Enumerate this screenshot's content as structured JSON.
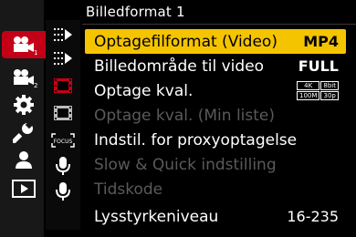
{
  "header": {
    "title": "Billedformat 1"
  },
  "menu": [
    {
      "label": "Optagefilformat (Video)",
      "value": "MP4",
      "state": "selected"
    },
    {
      "label": "Billedområde til video",
      "value": "FULL",
      "state": "normal"
    },
    {
      "label": "Optage kval.",
      "value": "",
      "state": "normal",
      "badge": [
        "4K",
        "8bit",
        "100M",
        "30p"
      ]
    },
    {
      "label": "Optage kval. (Min liste)",
      "value": "",
      "state": "disabled"
    },
    {
      "label": "Indstil. for proxyoptagelse",
      "value": "",
      "state": "normal"
    },
    {
      "label": "Slow & Quick indstilling",
      "value": "",
      "state": "disabled"
    },
    {
      "label": "Tidskode",
      "value": "",
      "state": "disabled"
    },
    {
      "label": "Lysstyrkeniveau",
      "value": "16-235",
      "state": "normal"
    }
  ],
  "tabs": [
    {
      "icon": "video-camera-icon",
      "sub": "1",
      "active": true
    },
    {
      "icon": "video-camera-icon",
      "sub": "2",
      "active": false
    },
    {
      "icon": "gear-icon",
      "active": false
    },
    {
      "icon": "wrench-icon",
      "active": false
    },
    {
      "icon": "person-icon",
      "active": false
    },
    {
      "icon": "playback-icon",
      "active": false
    }
  ],
  "subtabs": [
    {
      "icon": "image-format-icon"
    },
    {
      "icon": "image-format-icon"
    },
    {
      "icon": "film-strip-icon",
      "accent": true
    },
    {
      "icon": "film-strip-icon"
    },
    {
      "icon": "focus-icon",
      "label": "FOCUS"
    },
    {
      "icon": "microphone-icon"
    },
    {
      "icon": "microphone-icon"
    }
  ],
  "colors": {
    "accent_red": "#c40016",
    "highlight": "#f5c400",
    "disabled": "#5a5a5a"
  }
}
